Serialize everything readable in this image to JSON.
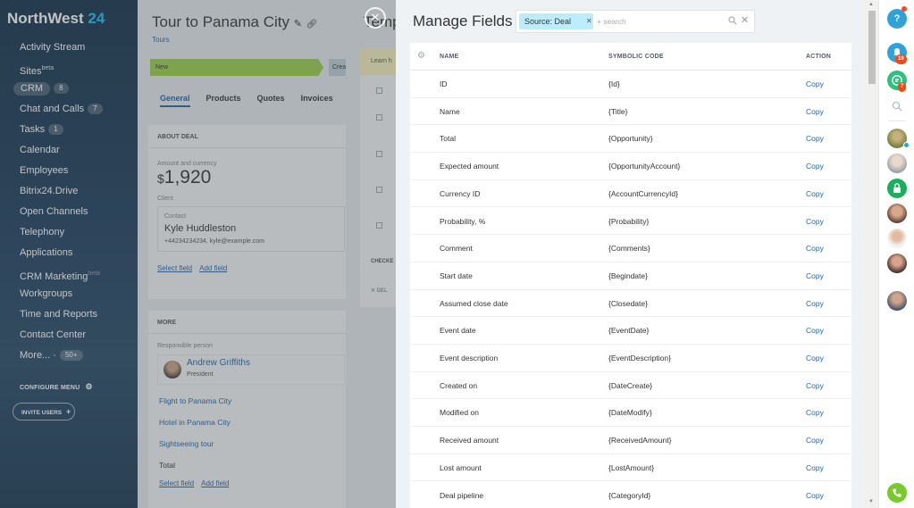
{
  "sidebar": {
    "logo_name": "NorthWest",
    "logo_num": "24",
    "items": [
      {
        "label": "Activity Stream",
        "badge": ""
      },
      {
        "label": "Sites",
        "sup": "beta",
        "badge": ""
      },
      {
        "label": "CRM",
        "badge": "8"
      },
      {
        "label": "Chat and Calls",
        "badge": "7"
      },
      {
        "label": "Tasks",
        "badge": "1"
      },
      {
        "label": "Calendar",
        "badge": ""
      },
      {
        "label": "Employees",
        "badge": ""
      },
      {
        "label": "Bitrix24.Drive",
        "badge": ""
      },
      {
        "label": "Open Channels",
        "badge": ""
      },
      {
        "label": "Telephony",
        "badge": ""
      },
      {
        "label": "Applications",
        "badge": ""
      },
      {
        "label": "CRM Marketing",
        "sup": "beta",
        "badge": ""
      },
      {
        "label": "Workgroups",
        "badge": ""
      },
      {
        "label": "Time and Reports",
        "badge": ""
      },
      {
        "label": "Contact Center",
        "badge": ""
      },
      {
        "label": "More... ·",
        "badge": "50+"
      }
    ],
    "configure_menu": "CONFIGURE MENU",
    "invite_users": "INVITE USERS"
  },
  "deal": {
    "title": "Tour to Panama City",
    "category": "Tours",
    "stage": "New",
    "stage_next": "Crea",
    "tabs": [
      "General",
      "Products",
      "Quotes",
      "Invoices"
    ],
    "about_header": "ABOUT DEAL",
    "amount_label": "Amount and currency",
    "currency_symbol": "$",
    "amount": "1,920",
    "client_label": "Client",
    "contact_label": "Contact",
    "contact_name": "Kyle Huddleston",
    "contact_details": "+44234234234, kyle@example.com",
    "select_field": "Select field",
    "add_field": "Add field",
    "more_header": "MORE",
    "responsible_label": "Responsible person",
    "responsible_name": "Andrew Griffiths",
    "responsible_role": "President",
    "products": [
      "Flight to Panama City",
      "Hotel in Panama City",
      "Sightseeing tour",
      "Total"
    ],
    "select_field2": "Select field",
    "add_field2": "Add field"
  },
  "middle": {
    "title": "Temp",
    "strip": "Learn h",
    "checked_label": "CHECKE",
    "delete_label": "DEL"
  },
  "panel": {
    "title": "Manage Fields",
    "filter_chip": "Source: Deal",
    "search_placeholder": "+ search",
    "columns": {
      "name": "NAME",
      "code": "SYMBOLIC CODE",
      "action": "ACTION"
    },
    "rows": [
      {
        "name": "ID",
        "code": "{Id}",
        "action": "Copy"
      },
      {
        "name": "Name",
        "code": "{Title}",
        "action": "Copy"
      },
      {
        "name": "Total",
        "code": "{Opportunity}",
        "action": "Copy"
      },
      {
        "name": "Expected amount",
        "code": "{OpportunityAccount}",
        "action": "Copy"
      },
      {
        "name": "Currency ID",
        "code": "{AccountCurrencyId}",
        "action": "Copy"
      },
      {
        "name": "Probability, %",
        "code": "{Probability}",
        "action": "Copy"
      },
      {
        "name": "Comment",
        "code": "{Comments}",
        "action": "Copy"
      },
      {
        "name": "Start date",
        "code": "{Begindate}",
        "action": "Copy"
      },
      {
        "name": "Assumed close date",
        "code": "{Closedate}",
        "action": "Copy"
      },
      {
        "name": "Event date",
        "code": "{EventDate}",
        "action": "Copy"
      },
      {
        "name": "Event description",
        "code": "{EventDescription}",
        "action": "Copy"
      },
      {
        "name": "Created on",
        "code": "{DateCreate}",
        "action": "Copy"
      },
      {
        "name": "Modified on",
        "code": "{DateModify}",
        "action": "Copy"
      },
      {
        "name": "Received amount",
        "code": "{ReceivedAmount}",
        "action": "Copy"
      },
      {
        "name": "Lost amount",
        "code": "{LostAmount}",
        "action": "Copy"
      },
      {
        "name": "Deal pipeline",
        "code": "{CategoryId}",
        "action": "Copy"
      }
    ]
  },
  "rightbar": {
    "help": "?",
    "notif_count": "19",
    "chat_count": "7"
  },
  "colors": {
    "accent": "#2067b0",
    "chip": "#bcedfc",
    "stage": "#9ed94a",
    "badge": "#f54819"
  }
}
